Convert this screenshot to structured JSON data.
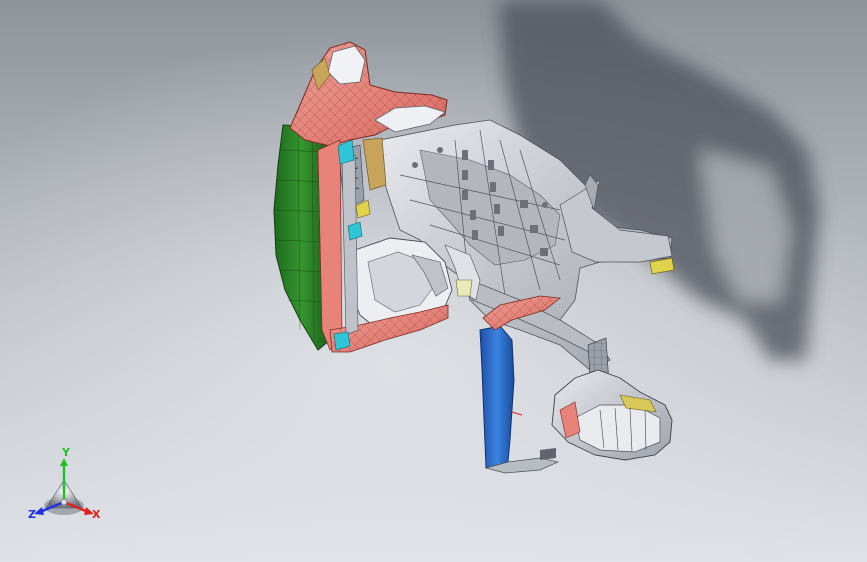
{
  "app": {
    "view": "CAD 3D viewport"
  },
  "triad": {
    "x_label": "X",
    "y_label": "Y",
    "z_label": "Z"
  },
  "colors": {
    "background_top": "#8f949b",
    "background_bottom": "#d9dde3",
    "shadow": "#50555c",
    "salmon_surface": "#e8837a",
    "green_surface": "#2f8a2c",
    "blue_surface": "#2f6fd0",
    "gray_surface": "#c9ccd3",
    "tan_surface": "#c9a55a",
    "cyan_surface": "#2fc4d6",
    "x_axis": "#e02020",
    "y_axis": "#20c020",
    "z_axis": "#2030e0"
  },
  "model": {
    "part_icon": "automotive-dashboard-assembly"
  }
}
